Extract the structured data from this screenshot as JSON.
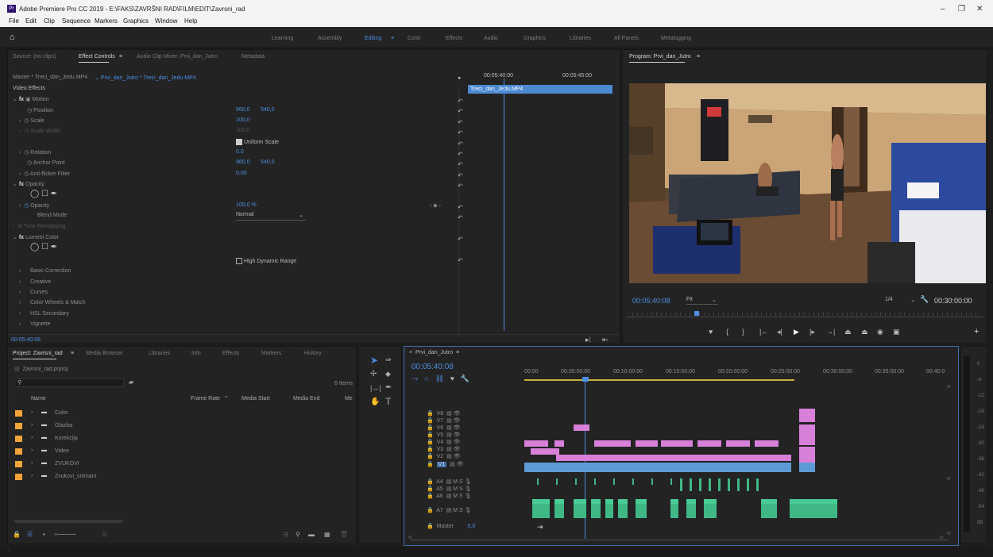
{
  "window": {
    "logo": "Pr",
    "title": "Adobe Premiere Pro CC 2019 - E:\\FAKS\\ZAVRŠNI RAD\\FILM\\EDIT\\Zavrsni_rad"
  },
  "menu": [
    "File",
    "Edit",
    "Clip",
    "Sequence",
    "Markers",
    "Graphics",
    "Window",
    "Help"
  ],
  "workspaces": [
    "Learning",
    "Assembly",
    "Editing",
    "Color",
    "Effects",
    "Audio",
    "Graphics",
    "Libraries",
    "All Panels",
    "Metalogging"
  ],
  "source_tabs": [
    "Source: (no clips)",
    "Effect Controls",
    "Audio Clip Mixer: Prvi_dan_Jutro",
    "Metadata"
  ],
  "ec": {
    "master": "Master * Treci_dan_Jedu.MP4",
    "seq": "Prvi_dan_Jutro * Treci_dan_Jedu.MP4",
    "t1": "00:05:40:00",
    "t2": "00:05:45:00",
    "clip": "Treci_dan_Jedu.MP4",
    "timecode": "00:05:40:08",
    "rows": [
      {
        "label": "Video Effects",
        "v1": "",
        "v2": ""
      },
      {
        "label": "Motion",
        "v1": "",
        "v2": ""
      },
      {
        "label": "Position",
        "v1": "960,0",
        "v2": "540,0"
      },
      {
        "label": "Scale",
        "v1": "100,0",
        "v2": ""
      },
      {
        "label": "Scale Width",
        "v1": "100,0",
        "v2": ""
      },
      {
        "label": "",
        "v1": "Uniform Scale",
        "v2": ""
      },
      {
        "label": "Rotation",
        "v1": "0,0",
        "v2": ""
      },
      {
        "label": "Anchor Point",
        "v1": "960,0",
        "v2": "540,0"
      },
      {
        "label": "Anti-flicker Filter",
        "v1": "0,00",
        "v2": ""
      },
      {
        "label": "Opacity",
        "v1": "",
        "v2": ""
      },
      {
        "label": "",
        "v1": "",
        "v2": ""
      },
      {
        "label": "Opacity",
        "v1": "100,0 %",
        "v2": ""
      },
      {
        "label": "Blend Mode",
        "v1": "Normal",
        "v2": ""
      },
      {
        "label": "Time Remapping",
        "v1": "",
        "v2": ""
      },
      {
        "label": "Lumetri Color",
        "v1": "",
        "v2": ""
      },
      {
        "label": "",
        "v1": "",
        "v2": ""
      },
      {
        "label": "",
        "v1": "High Dynamic Range",
        "v2": ""
      },
      {
        "label": "Basic Correction",
        "v1": "",
        "v2": ""
      },
      {
        "label": "Creative",
        "v1": "",
        "v2": ""
      },
      {
        "label": "Curves",
        "v1": "",
        "v2": ""
      },
      {
        "label": "Color Wheels & Match",
        "v1": "",
        "v2": ""
      },
      {
        "label": "HSL Secondary",
        "v1": "",
        "v2": ""
      },
      {
        "label": "Vignette",
        "v1": "",
        "v2": ""
      }
    ]
  },
  "program": {
    "title": "Program: Prvi_dan_Jutro",
    "timecode": "00:05:40:08",
    "fit": "Fit",
    "quality": "1/4",
    "duration": "00:30:00:00"
  },
  "project": {
    "tabs": [
      "Project: Zavrsni_rad",
      "Media Browser",
      "Libraries",
      "Info",
      "Effects",
      "Markers",
      "History"
    ],
    "file": "Zavrsni_rad.prproj",
    "count": "6 Items",
    "cols": [
      "Name",
      "Frame Rate",
      "Media Start",
      "Media End",
      "Me"
    ],
    "bins": [
      "Color",
      "Glazba",
      "Korekcija",
      "Video",
      "ZVUKOVI",
      "Zvukovi_snimani"
    ]
  },
  "timeline": {
    "seq": "Prvi_dan_Jutro",
    "timecode": "00:05:40:08",
    "ruler": [
      "00:00",
      "00:05:00:00",
      "00:10:00:00",
      "00:15:00:00",
      "00:20:00:00",
      "00:25:00:00",
      "00:30:00:00",
      "00:35:00:00",
      "00:40:0"
    ],
    "vtracks": [
      "V8",
      "V7",
      "V6",
      "V5",
      "V4",
      "V3",
      "V2",
      "V1"
    ],
    "atracks": [
      "A4",
      "A5",
      "A6",
      "A7"
    ],
    "master": "Master",
    "master_val": "0,0",
    "meter": [
      "0",
      "-6",
      "-12",
      "-18",
      "-24",
      "-30",
      "-36",
      "-42",
      "-48",
      "-54",
      "dB"
    ]
  }
}
